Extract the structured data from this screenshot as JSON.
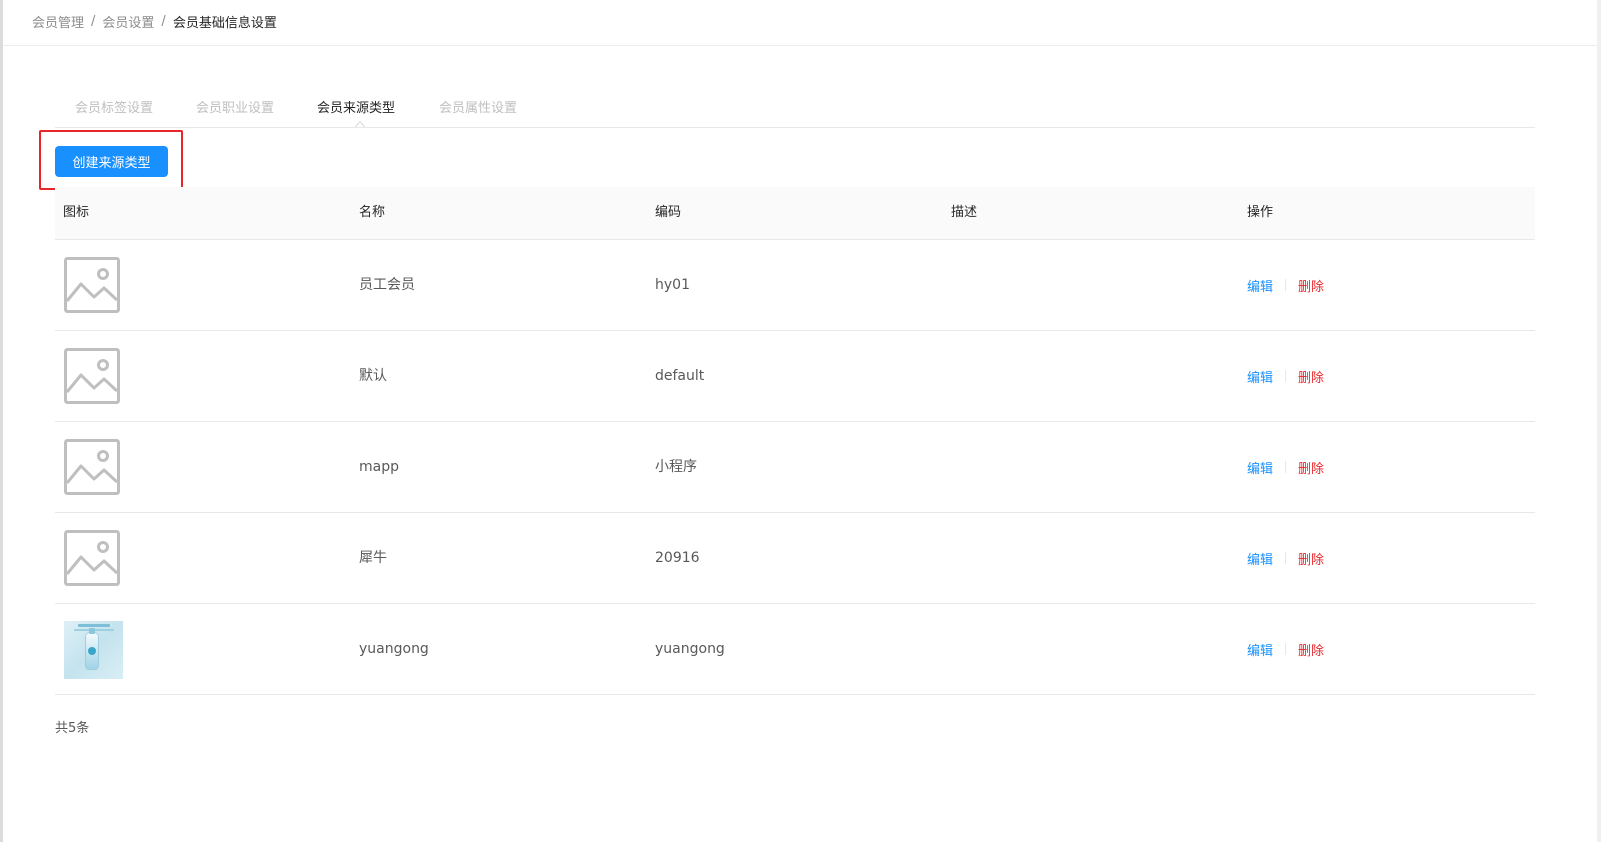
{
  "breadcrumb": {
    "items": [
      {
        "label": "会员管理"
      },
      {
        "label": "会员设置"
      },
      {
        "label": "会员基础信息设置"
      }
    ],
    "separator": "/"
  },
  "tabs": [
    {
      "label": "会员标签设置",
      "active": false
    },
    {
      "label": "会员职业设置",
      "active": false
    },
    {
      "label": "会员来源类型",
      "active": true
    },
    {
      "label": "会员属性设置",
      "active": false
    }
  ],
  "toolbar": {
    "create_label": "创建来源类型"
  },
  "table": {
    "columns": [
      "图标",
      "名称",
      "编码",
      "描述",
      "操作"
    ],
    "rows": [
      {
        "icon": "image-placeholder-icon",
        "name": "员工会员",
        "code": "hy01",
        "description": "",
        "edit": "编辑",
        "delete": "删除"
      },
      {
        "icon": "image-placeholder-icon",
        "name": "默认",
        "code": "default",
        "description": "",
        "edit": "编辑",
        "delete": "删除"
      },
      {
        "icon": "image-placeholder-icon",
        "name": "mapp",
        "code": "小程序",
        "description": "",
        "edit": "编辑",
        "delete": "删除"
      },
      {
        "icon": "image-placeholder-icon",
        "name": "犀牛",
        "code": "20916",
        "description": "",
        "edit": "编辑",
        "delete": "删除"
      },
      {
        "icon": "product-thumbnail",
        "name": "yuangong",
        "code": "yuangong",
        "description": "",
        "edit": "编辑",
        "delete": "删除"
      }
    ]
  },
  "footer": {
    "total": "共5条"
  },
  "colors": {
    "primary": "#1890ff",
    "danger": "#e8262a",
    "highlight_border": "#e8262a"
  }
}
